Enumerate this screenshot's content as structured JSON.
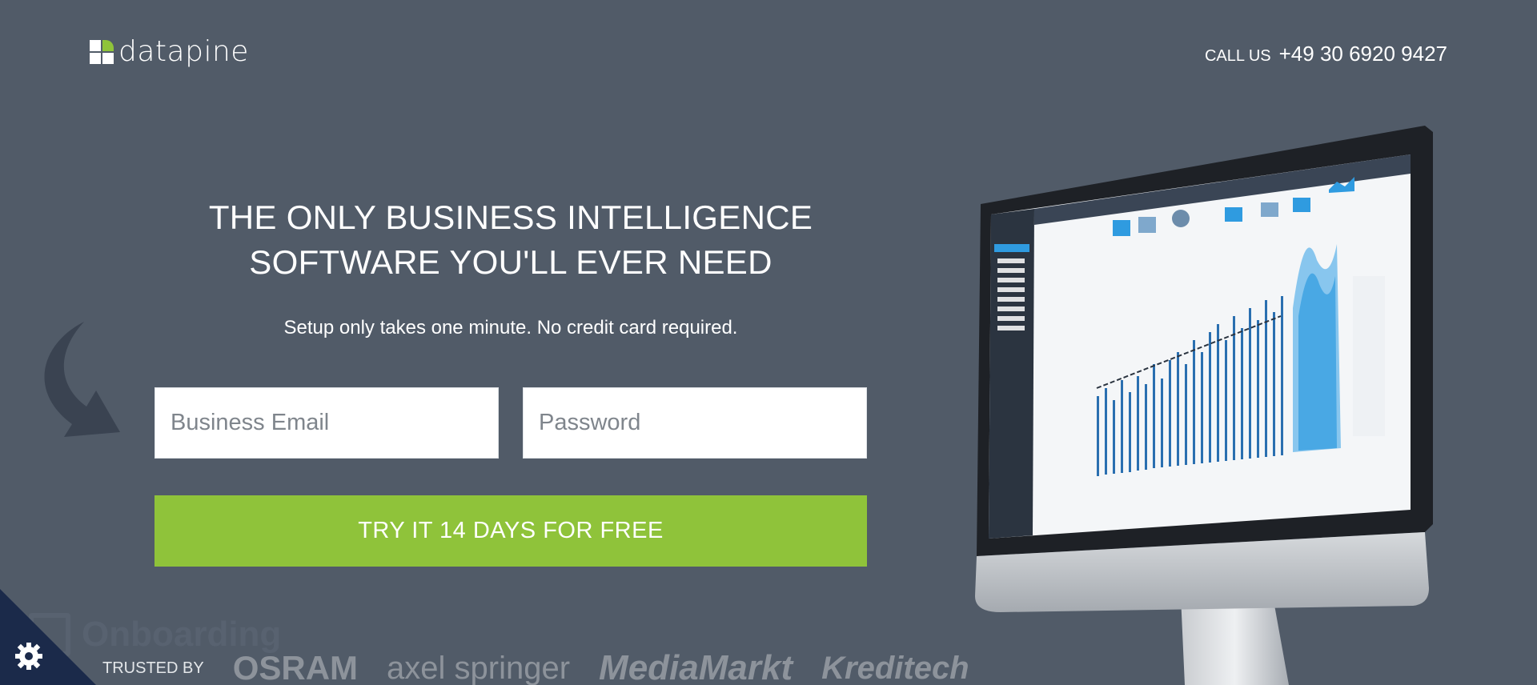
{
  "header": {
    "logo_text": "datapine",
    "call_label": "CALL US",
    "phone": "+49 30 6920 9427"
  },
  "hero": {
    "headline_line1": "THE ONLY BUSINESS INTELLIGENCE",
    "headline_line2": "SOFTWARE YOU'LL EVER NEED",
    "subheadline": "Setup only takes one minute. No credit card required."
  },
  "form": {
    "email_placeholder": "Business Email",
    "password_placeholder": "Password",
    "submit_label": "TRY IT 14 DAYS FOR FREE"
  },
  "trusted": {
    "label": "TRUSTED BY",
    "brands": [
      "OSRAM",
      "axel springer",
      "MediaMarkt",
      "Kreditech"
    ]
  },
  "overlay": {
    "onboarding_text": "Onboarding"
  },
  "colors": {
    "background": "#515b68",
    "accent_green": "#8fc33a",
    "screen_accent": "#2f9be0"
  },
  "icons": {
    "cookie_settings": "gear-icon",
    "arrow": "curved-arrow-icon"
  }
}
